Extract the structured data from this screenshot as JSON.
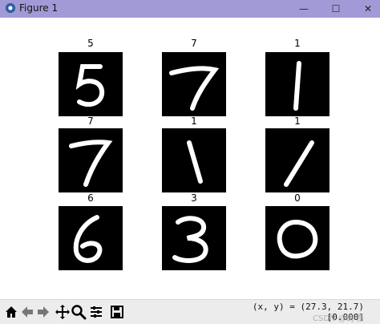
{
  "window": {
    "title": "Figure 1",
    "buttons": {
      "minimize": "—",
      "maximize": "☐",
      "close": "✕"
    }
  },
  "figure": {
    "grid": [
      {
        "title": "5"
      },
      {
        "title": "7"
      },
      {
        "title": "1"
      },
      {
        "title": "7"
      },
      {
        "title": "1"
      },
      {
        "title": "1"
      },
      {
        "title": "6"
      },
      {
        "title": "3"
      },
      {
        "title": "0"
      }
    ]
  },
  "toolbar": {
    "icons": [
      "home-icon",
      "back-icon",
      "forward-icon",
      "pan-icon",
      "zoom-icon",
      "configure-icon",
      "save-icon"
    ],
    "coords_line1": "(x, y) = (27.3, 21.7)",
    "coords_line2": "[0.000]"
  },
  "watermark": "CSDN @Bj  吾"
}
